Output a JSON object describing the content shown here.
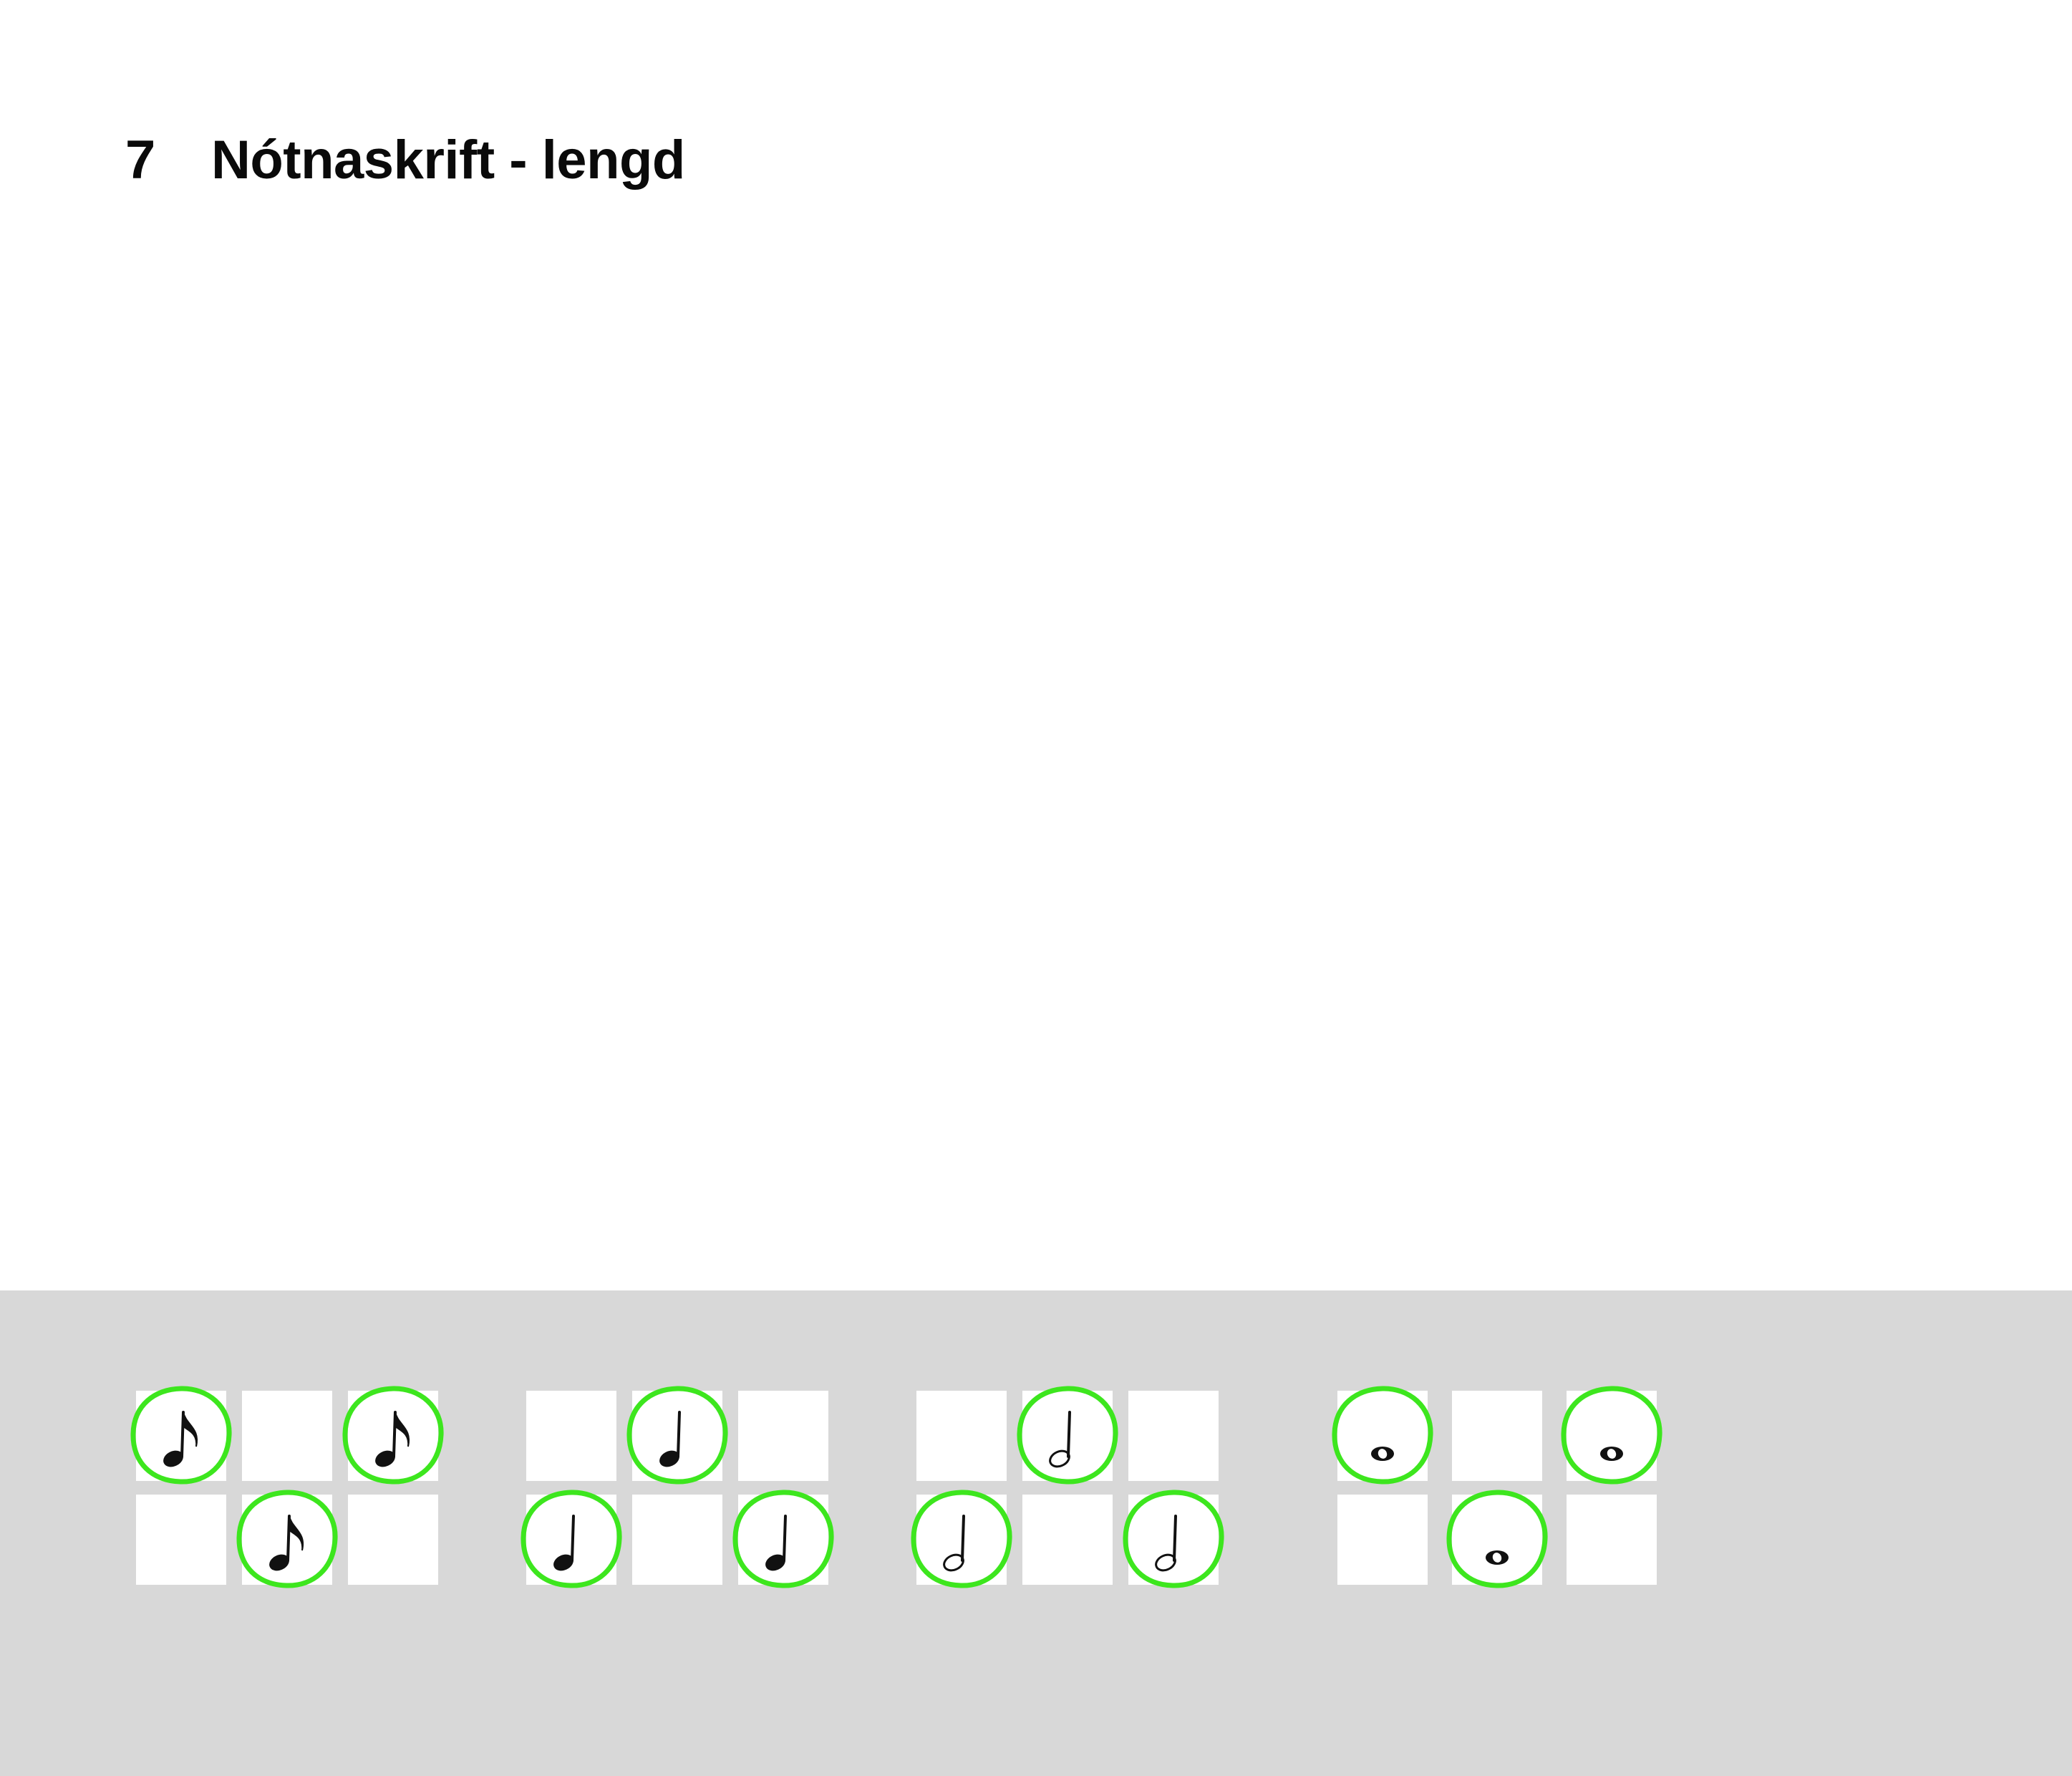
{
  "page": {
    "section_number": "7",
    "section_title": "Nótnaskrift - lengd"
  },
  "colors": {
    "tray_background": "#d8d8d8",
    "cell_background": "#ffffff",
    "selection_ring": "#3de61e",
    "note_color": "#111111"
  },
  "note_groups": [
    {
      "note_type": "eighth",
      "icon": "eighth-note-icon",
      "cells": [
        {
          "row": 0,
          "col": 0,
          "note": true,
          "selected": true
        },
        {
          "row": 0,
          "col": 1,
          "note": false,
          "selected": false
        },
        {
          "row": 0,
          "col": 2,
          "note": true,
          "selected": true
        },
        {
          "row": 1,
          "col": 0,
          "note": false,
          "selected": false
        },
        {
          "row": 1,
          "col": 1,
          "note": true,
          "selected": true
        },
        {
          "row": 1,
          "col": 2,
          "note": false,
          "selected": false
        }
      ]
    },
    {
      "note_type": "quarter",
      "icon": "quarter-note-icon",
      "cells": [
        {
          "row": 0,
          "col": 0,
          "note": false,
          "selected": false
        },
        {
          "row": 0,
          "col": 1,
          "note": true,
          "selected": true
        },
        {
          "row": 0,
          "col": 2,
          "note": false,
          "selected": false
        },
        {
          "row": 1,
          "col": 0,
          "note": true,
          "selected": true
        },
        {
          "row": 1,
          "col": 1,
          "note": false,
          "selected": false
        },
        {
          "row": 1,
          "col": 2,
          "note": true,
          "selected": true
        }
      ]
    },
    {
      "note_type": "half",
      "icon": "half-note-icon",
      "cells": [
        {
          "row": 0,
          "col": 0,
          "note": false,
          "selected": false
        },
        {
          "row": 0,
          "col": 1,
          "note": true,
          "selected": true
        },
        {
          "row": 0,
          "col": 2,
          "note": false,
          "selected": false
        },
        {
          "row": 1,
          "col": 0,
          "note": true,
          "selected": true
        },
        {
          "row": 1,
          "col": 1,
          "note": false,
          "selected": false
        },
        {
          "row": 1,
          "col": 2,
          "note": true,
          "selected": true
        }
      ]
    },
    {
      "note_type": "whole",
      "icon": "whole-note-icon",
      "cells": [
        {
          "row": 0,
          "col": 0,
          "note": true,
          "selected": true
        },
        {
          "row": 0,
          "col": 1,
          "note": false,
          "selected": false
        },
        {
          "row": 0,
          "col": 2,
          "note": true,
          "selected": true
        },
        {
          "row": 1,
          "col": 0,
          "note": false,
          "selected": false
        },
        {
          "row": 1,
          "col": 1,
          "note": true,
          "selected": true
        },
        {
          "row": 1,
          "col": 2,
          "note": false,
          "selected": false
        }
      ]
    }
  ]
}
